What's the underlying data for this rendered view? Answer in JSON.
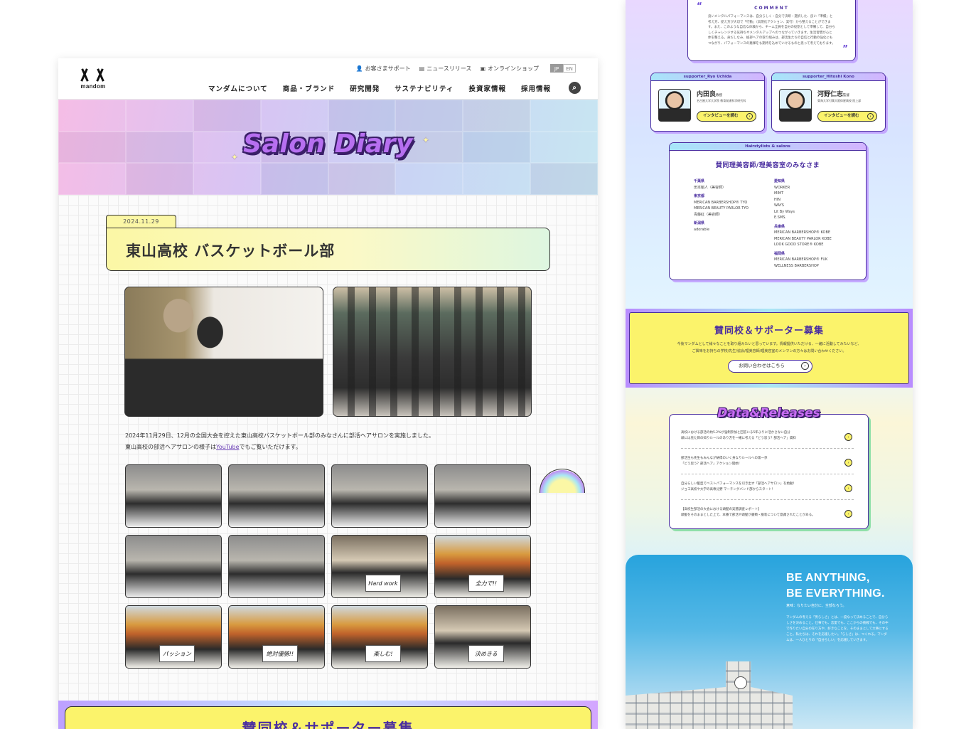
{
  "site": {
    "logo_text": "mandom",
    "utility_nav": [
      {
        "icon": "person-icon",
        "label": "お客さまサポート"
      },
      {
        "icon": "document-icon",
        "label": "ニュースリリース"
      },
      {
        "icon": "bag-icon",
        "label": "オンラインショップ"
      }
    ],
    "lang": {
      "jp": "JP",
      "en": "EN"
    },
    "main_nav": [
      "マンダムについて",
      "商品・ブランド",
      "研究開発",
      "サステナビリティ",
      "投資家情報",
      "採用情報"
    ],
    "hero_title": "Salon Diary"
  },
  "article": {
    "date": "2024.11.29",
    "title": "東山高校 バスケットボール部",
    "body_line1": "2024年11月29日、12月の全国大会を控えた東山高校バスケットボール部のみなさんに部活ヘアサロンを実施しました。",
    "body_line2_prefix": "東山高校の部活ヘアサロンの様子は",
    "body_link": "YouTube",
    "body_line2_suffix": "でもご覧いただけます。",
    "photo_cards": [
      "Hard work",
      "全力で!!",
      "パッション",
      "絶対優勝!!",
      "楽しむ!",
      "決めきる"
    ],
    "recruit_heading": "賛同校＆サポーター募集"
  },
  "sidebar": {
    "comment_title": "COMMENT",
    "comment_text": "良いメンタルパフォーマンスは、自分らしく・自分で決断・選択した、良い「準備」と考え方、捉え方が大切で「行動」（具現化アクション、実行）から整えることができます。また、このような自信な体験から、チーム全員を自分の役割として準備して、自分らしくチャレンジする気持ちやメンタルアップへのつながっていきます。生活習慣が心と体を整える。身だしなみ、挨拶ヘアの取り組みは、部活生たちの自信と行動の強化にもつながり、パフォーマンスの発揮をも期待を込めていけるものと思って考えております。",
    "supporters": [
      {
        "header": "supporter_Ryo Uchida",
        "name": "内田良",
        "title": "教授",
        "affiliation": "名古屋大学大学院 教育発達科学研究科",
        "button": "インタビューを読む"
      },
      {
        "header": "supporter_Hitoshi Kono",
        "name": "河野仁志",
        "title": "監督",
        "affiliation": "東海大学付属大阪仰星高校 陸上部",
        "button": "インタビューを読む"
      }
    ],
    "salons_header": "Hairstylists & salons",
    "salons_title": "賛同理美容師/理美容室のみなさま",
    "salons_left": [
      {
        "pref": "千葉県",
        "items": [
          "田本魁人（美容師）"
        ]
      },
      {
        "pref": "東京都",
        "items": [
          "MERICAN BARBERSHOP® TYO",
          "MERICAN BEAUTY PARLOR TYO",
          "青藤紅（美容師）"
        ]
      },
      {
        "pref": "新潟県",
        "items": [
          "adorable"
        ]
      }
    ],
    "salons_right": [
      {
        "pref": "愛知県",
        "items": [
          "WORKER",
          "MIMT",
          "HIN",
          "WAYS",
          "Lit By Ways",
          "E.SMS."
        ]
      },
      {
        "pref": "兵庫県",
        "items": [
          "MERICAN BARBERSHOP® KOBE",
          "MERICAN BEAUTY PARLOR KOBE",
          "LOOK GOOD STORE® KOBE"
        ]
      },
      {
        "pref": "福岡県",
        "items": [
          "MERICAN BARBERSHOP® FUK",
          "WELLNESS BARBERSHOP"
        ]
      }
    ],
    "recruit_title": "賛同校＆サポーター募集",
    "recruit_text1": "今後マンダムとして様々なことを取り組みたいと思っています。情報提供いただける、一緒に活動してみたいなど、",
    "recruit_text2": "ご興味をお持ちの学校/先生/協会/理美容師/理美容室のメンマンの方々はお問い合わせください。",
    "recruit_button": "お問い合わせはこちら",
    "releases_title": "Data&Releases",
    "releases": [
      {
        "line1": "高校における部活の約5.2%が強制参加と回答いる5年ぶりに活かさない自分",
        "line2": "頭には見た目の知りルールのあり方を一緒に考える「どう思う？部活ヘア」資料"
      },
      {
        "line1": "部活生も先生もみんなが納得のいく身なりルールへの第一歩",
        "line2": "「どう思う？部活ヘア」アクション開始！"
      },
      {
        "line1": "自分らしい髪型でベストパフォーマンスを引き出す「部活ヘアサロン」を始動！",
        "line2": "ジョコ高校や大学の高専分野 マーチングバンド部からスタート！"
      },
      {
        "line1": "【高校生部活の大会における頭髪の実態調査レポート】",
        "line2": "頭髪をそのままとした上で、本番で部活や頭髪が書類・服装について意識されたことがある。"
      }
    ],
    "brand_title_line1": "BE ANYTHING,",
    "brand_title_line2": "BE EVERYTHING.",
    "brand_sub": "意味：なりたい自分に、全部なろう。",
    "brand_text": "マンダムの考える「男らしさ」とは、一度なって決めることで、自分らしさを決めること。仕事でも、恋愛でも、ここからの挑戦でも、その中で作りたい自分の在り方や、好きなことを、そのままとして大事にすること。私たちは、それを応援したい。「らしさ」は、つくれる。マンダムは、一人ひとりの「自分らしい」を応援していきます。"
  }
}
